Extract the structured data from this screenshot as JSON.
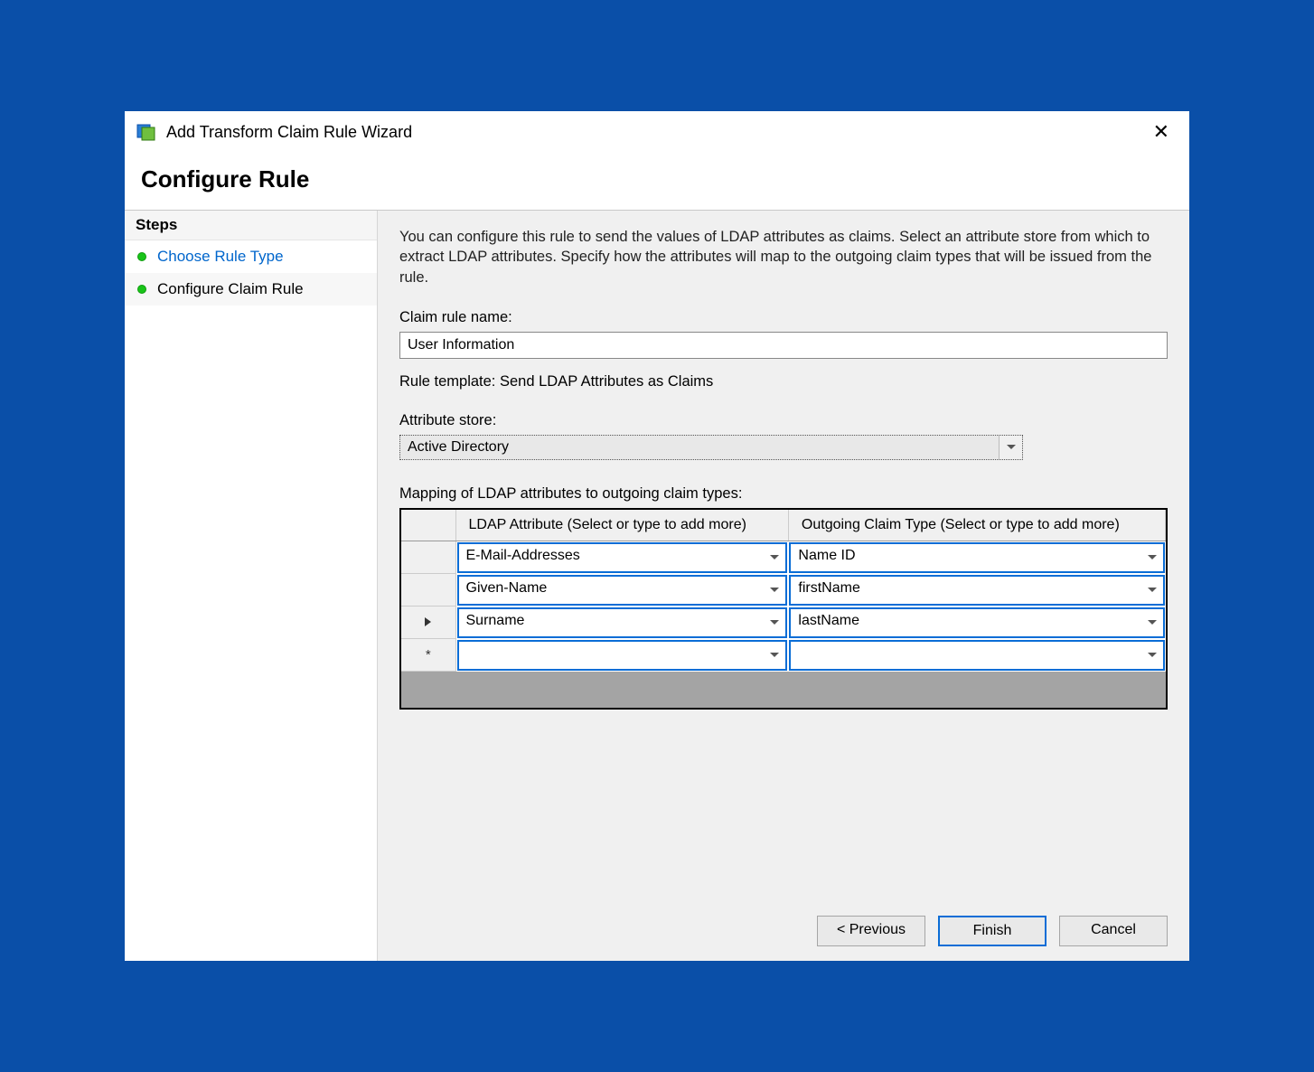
{
  "window": {
    "title": "Add Transform Claim Rule Wizard",
    "heading": "Configure Rule",
    "close_label": "✕"
  },
  "sidebar": {
    "header": "Steps",
    "items": [
      {
        "label": "Choose Rule Type",
        "state": "done-link"
      },
      {
        "label": "Configure Claim Rule",
        "state": "current"
      }
    ]
  },
  "content": {
    "description": "You can configure this rule to send the values of LDAP attributes as claims. Select an attribute store from which to extract LDAP attributes. Specify how the attributes will map to the outgoing claim types that will be issued from the rule.",
    "claim_rule_name_label": "Claim rule name:",
    "claim_rule_name_value": "User Information",
    "rule_template_label": "Rule template: Send LDAP Attributes as Claims",
    "attribute_store_label": "Attribute store:",
    "attribute_store_value": "Active Directory",
    "mapping_label": "Mapping of LDAP attributes to outgoing claim types:",
    "grid": {
      "col1_header": "LDAP Attribute (Select or type to add more)",
      "col2_header": "Outgoing Claim Type (Select or type to add more)",
      "rows": [
        {
          "indicator": "",
          "ldap": "E-Mail-Addresses",
          "claim": "Name ID"
        },
        {
          "indicator": "",
          "ldap": "Given-Name",
          "claim": "firstName"
        },
        {
          "indicator": "▶",
          "ldap": "Surname",
          "claim": "lastName"
        },
        {
          "indicator": "*",
          "ldap": "",
          "claim": ""
        }
      ]
    }
  },
  "footer": {
    "previous": "< Previous",
    "finish": "Finish",
    "cancel": "Cancel"
  }
}
